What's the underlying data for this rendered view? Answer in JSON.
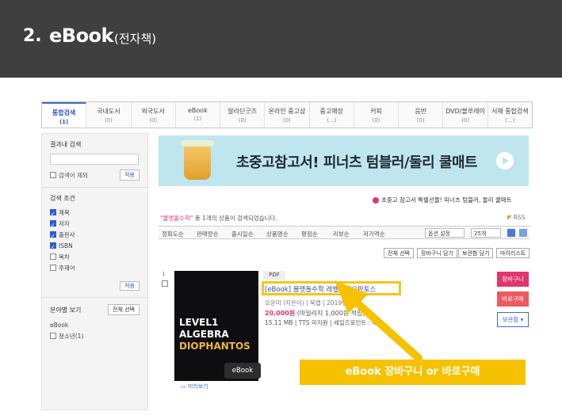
{
  "header": {
    "num": "2.",
    "title": "eBook",
    "sub": "(전자책)"
  },
  "tabs": [
    {
      "label": "통합검색",
      "count": "(1)",
      "active": true
    },
    {
      "label": "국내도서",
      "count": "(0)"
    },
    {
      "label": "외국도서",
      "count": "(0)"
    },
    {
      "label": "eBook",
      "count": "(1)"
    },
    {
      "label": "알라딘굿즈",
      "count": "(0)"
    },
    {
      "label": "온라인 중고샵",
      "count": "(0)"
    },
    {
      "label": "중고매장",
      "count": "(...)"
    },
    {
      "label": "커피",
      "count": "(0)"
    },
    {
      "label": "음반",
      "count": "(0)"
    },
    {
      "label": "DVD/블루레이",
      "count": "(0)"
    },
    {
      "label": "서재 통합검색",
      "count": "(...)"
    }
  ],
  "sidebar": {
    "within_title": "결과내 검색",
    "except_label": "검색어 제외",
    "apply": "적용",
    "cond_title": "검색 조건",
    "conditions": [
      {
        "label": "제목",
        "checked": true
      },
      {
        "label": "저자",
        "checked": true
      },
      {
        "label": "출판사",
        "checked": true
      },
      {
        "label": "ISBN",
        "checked": true
      },
      {
        "label": "목차",
        "checked": false
      },
      {
        "label": "주제어",
        "checked": false
      }
    ],
    "cat_title": "분야별 보기",
    "cat_all": "전체 선택",
    "cat_ebook": "eBook",
    "cat_sub": "청소년(1)"
  },
  "banner": {
    "text": "초중고참고서! 피너츠 텀블러/둘리 쿨매트"
  },
  "promo": "초중고 참고서 특별선물! 피너츠 텀블러, 둘리 쿨매트",
  "results": {
    "keyword": "\"물맷돌수학\"",
    "text": " 총 1개의 상품이 검색되었습니다.",
    "rss": "RSS"
  },
  "sort": {
    "options": [
      "정확도순",
      "판매량순",
      "출시일순",
      "상품명순",
      "평점순",
      "리뷰순",
      "저가격순"
    ],
    "select1": "옵션 설정",
    "select2": "25개"
  },
  "actions": [
    "전체 선택",
    "장바구니 담기",
    "보관함 담기",
    "마이리스트"
  ],
  "product": {
    "num": "1",
    "format": "PDF",
    "title": "[eBook] 물맷돌수학 레벨1 디오판토스",
    "meta": "오운미 (지은이) | 북랩 | 2019년 8월",
    "price": "20,000원",
    "price_extra": " (마일리지 1,000원 적립)",
    "file": "15.11 MB | TTS 미지원 | 세일즈포인트 : 40",
    "cover_l1": "LEVEL1",
    "cover_l2": "ALGEBRA",
    "cover_l3": "DIOPHANTOS",
    "badge": "eBook",
    "preview": "미리보기"
  },
  "buttons": {
    "cart": "장바구니",
    "buy": "바로구매",
    "keep": "보관함 ▾"
  },
  "callout": "eBook 장바구니 or 바로구매"
}
